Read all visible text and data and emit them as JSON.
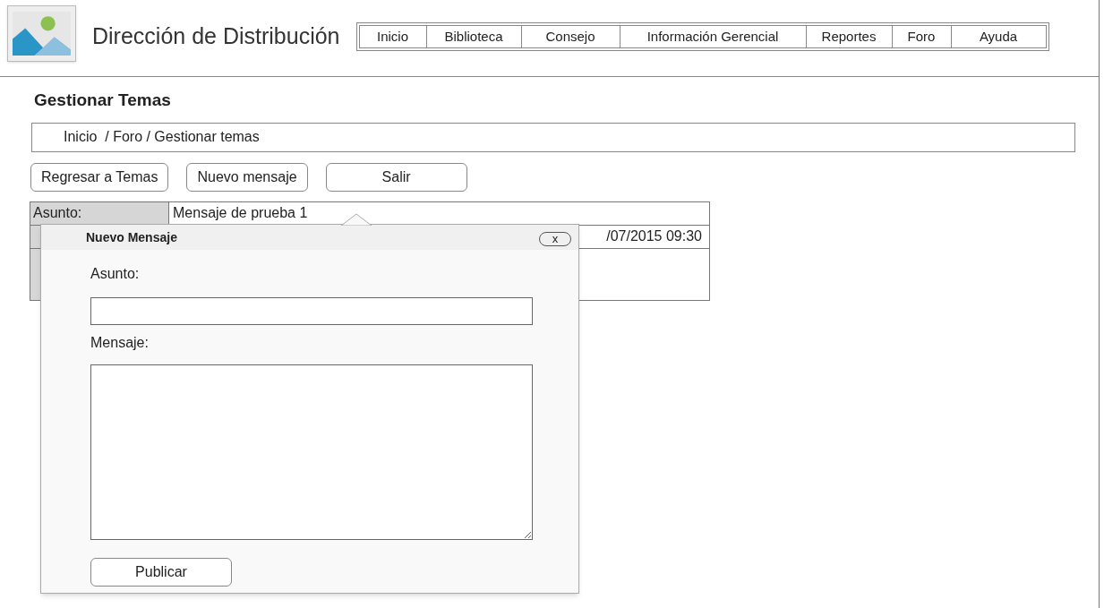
{
  "header": {
    "title": "Dirección de Distribución"
  },
  "nav": [
    {
      "label": "Inicio"
    },
    {
      "label": "Biblioteca"
    },
    {
      "label": "Consejo"
    },
    {
      "label": "Información Gerencial"
    },
    {
      "label": "Reportes"
    },
    {
      "label": "Foro"
    },
    {
      "label": "Ayuda"
    }
  ],
  "page_title": "Gestionar Temas",
  "breadcrumb": "Inicio  / Foro / Gestionar temas",
  "buttons": [
    "Regresar a Temas",
    "Nuevo mensaje",
    "Salir"
  ],
  "topic": {
    "subject_label": "Asunto:",
    "subject": "Mensaje de prueba 1",
    "date": "/07/2015 09:30"
  },
  "dialog": {
    "title": "Nuevo Mensaje",
    "close": "x",
    "subject_label": "Asunto:",
    "message_label": "Mensaje:",
    "submit": "Publicar"
  }
}
